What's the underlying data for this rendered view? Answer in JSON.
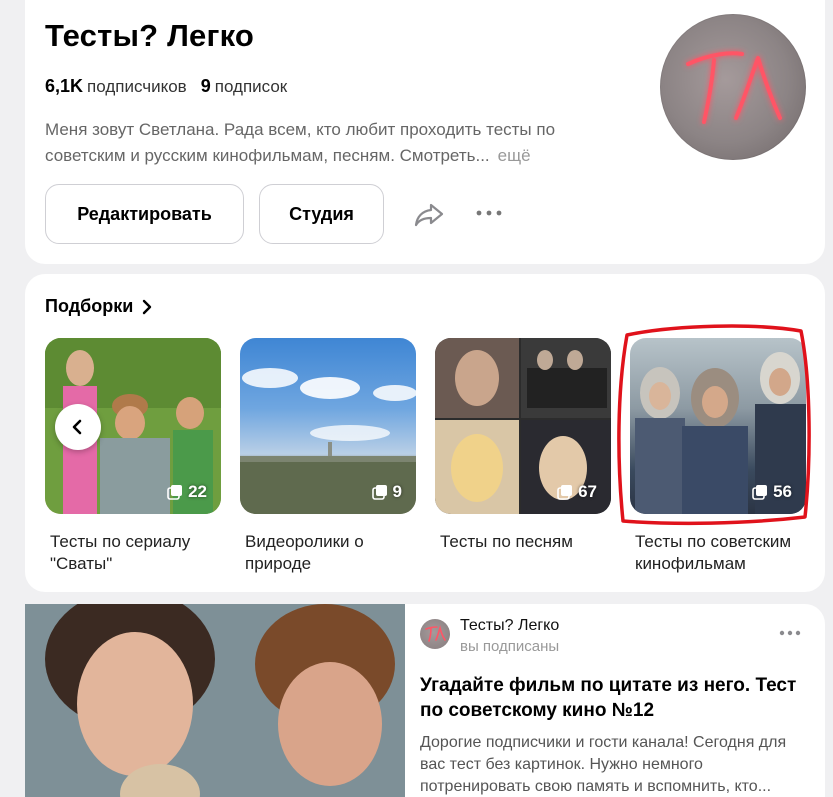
{
  "channel": {
    "title": "Тесты? Легко",
    "subscribers_count": "6,1K",
    "subscribers_label": "подписчиков",
    "subscriptions_count": "9",
    "subscriptions_label": "подписок",
    "description": "Меня зовут Светлана. Рада всем, кто любит проходить тесты по советским и русским кинофильмам, песням. Смотреть...",
    "more_label": "ещё",
    "avatar_text": "ТЛ",
    "avatar_icon": "neon-logo-icon"
  },
  "actions": {
    "edit_label": "Редактировать",
    "studio_label": "Студия",
    "share_icon": "share-icon",
    "more_icon": "more-dots-icon"
  },
  "collections": {
    "section_title": "Подборки",
    "items": [
      {
        "caption": "Тесты по сериалу \"Сваты\"",
        "count": "22"
      },
      {
        "caption": "Видеоролики о природе",
        "count": "9"
      },
      {
        "caption": "Тесты по песням",
        "count": "67"
      },
      {
        "caption": "Тесты по советским кинофильмам",
        "count": "56"
      }
    ]
  },
  "post": {
    "author": "Тесты? Легко",
    "status": "вы подписаны",
    "title": "Угадайте фильм по цитате из него. Тест по советскому кино №12",
    "text": "Дорогие подписчики и гости канала! Сегодня для вас тест без картинок. Нужно немного потренировать свою память и вспомнить, кто..."
  },
  "colors": {
    "background": "#f0f0f2",
    "card": "#ffffff",
    "highlight": "#e0121b",
    "neon": "#ff4a5a"
  }
}
